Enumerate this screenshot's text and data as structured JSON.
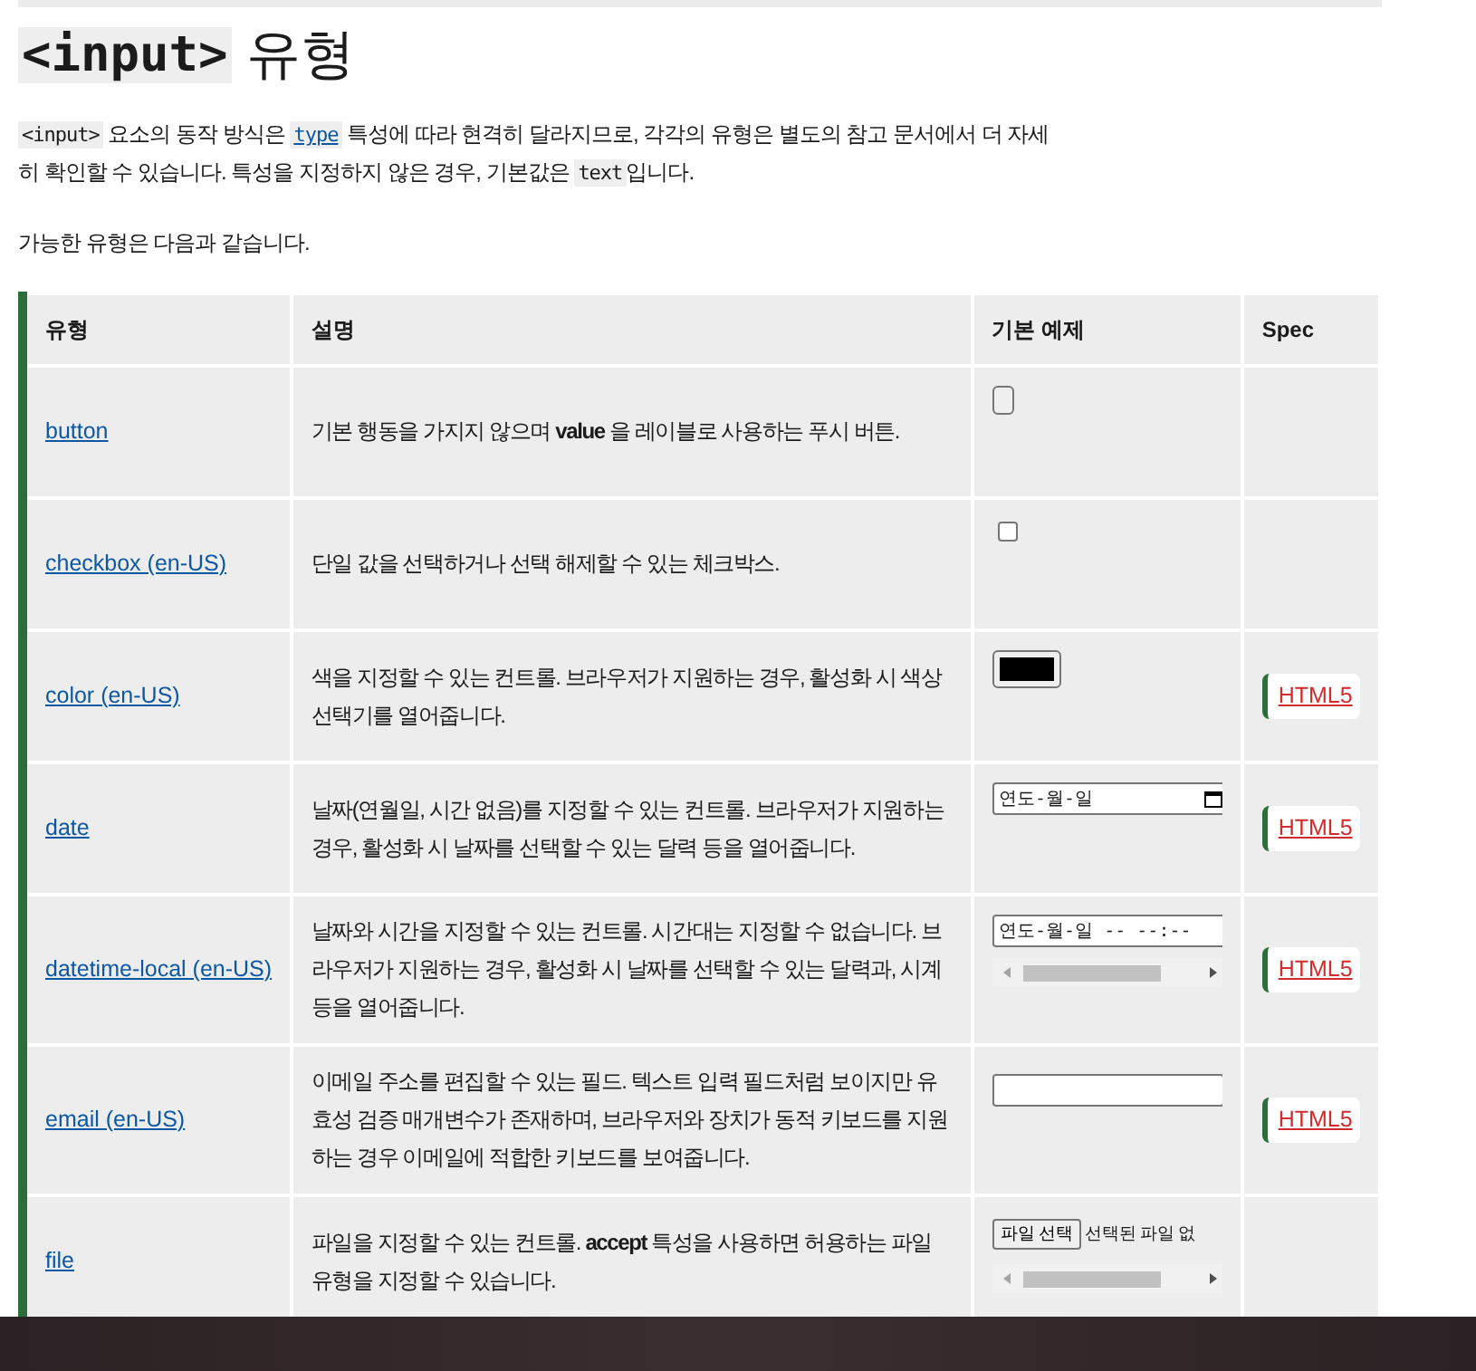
{
  "heading": {
    "code": "<input>",
    "text": "유형"
  },
  "intro": [
    {
      "kind": "code",
      "text": "<input>"
    },
    {
      "kind": "text",
      "text": " 요소의 동작 방식은 "
    },
    {
      "kind": "link",
      "text": "type"
    },
    {
      "kind": "text",
      "text": " 특성에 따라 현격히 달라지므로, 각각의 유형은 별도의 참고 문서에서 더 자세히 확인할 수 있습니다. 특성을 지정하지 않은 경우, 기본값은 "
    },
    {
      "kind": "code",
      "text": "text"
    },
    {
      "kind": "text",
      "text": "입니다."
    }
  ],
  "lead": "가능한 유형은 다음과 같습니다.",
  "table": {
    "columns": [
      "유형",
      "설명",
      "기본 예제",
      "Spec"
    ],
    "rows": [
      {
        "type": "button",
        "description": "기본 행동을 가지지 않으며 **value** 을 레이블로 사용하는 푸시 버튼.",
        "example": {
          "kind": "button"
        }
      },
      {
        "type": "checkbox (en-US)",
        "description": "단일 값을 선택하거나 선택 해제할 수 있는 체크박스.",
        "example": {
          "kind": "checkbox",
          "checked": false
        }
      },
      {
        "type": "color (en-US)",
        "description": "색을 지정할 수 있는 컨트롤. 브라우저가 지원하는 경우, 활성화 시 색상 선택기를 열어줍니다.",
        "example": {
          "kind": "color",
          "color": "#000000"
        },
        "spec": "HTML5"
      },
      {
        "type": "date",
        "description": "날짜(연월일, 시간 없음)를 지정할 수 있는 컨트롤. 브라우저가 지원하는 경우, 활성화 시 날짜를 선택할 수 있는 달력 등을 열어줍니다.",
        "example": {
          "kind": "date",
          "placeholder": "연도-월-일"
        },
        "spec": "HTML5"
      },
      {
        "type": "datetime-local (en-US)",
        "description": "날짜와 시간을 지정할 수 있는 컨트롤. 시간대는 지정할 수 없습니다. 브라우저가 지원하는 경우, 활성화 시 날짜를 선택할 수 있는 달력과, 시계 등을 열어줍니다.",
        "example": {
          "kind": "datetime",
          "placeholder": "연도-월-일 -- --:--"
        },
        "spec": "HTML5"
      },
      {
        "type": "email (en-US)",
        "description": "이메일 주소를 편집할 수 있는 필드. 텍스트 입력 필드처럼 보이지만 유효성 검증 매개변수가 존재하며, 브라우저와 장치가 동적 키보드를 지원하는 경우 이메일에 적합한 키보드를 보여줍니다.",
        "example": {
          "kind": "email"
        },
        "spec": "HTML5"
      },
      {
        "type": "file",
        "description": "파일을 지정할 수 있는 컨트롤. **accept** 특성을 사용하면 허용하는 파일 유형을 지정할 수 있습니다.",
        "example": {
          "kind": "file",
          "button": "파일 선택",
          "status": "선택된 파일 없"
        }
      }
    ]
  }
}
